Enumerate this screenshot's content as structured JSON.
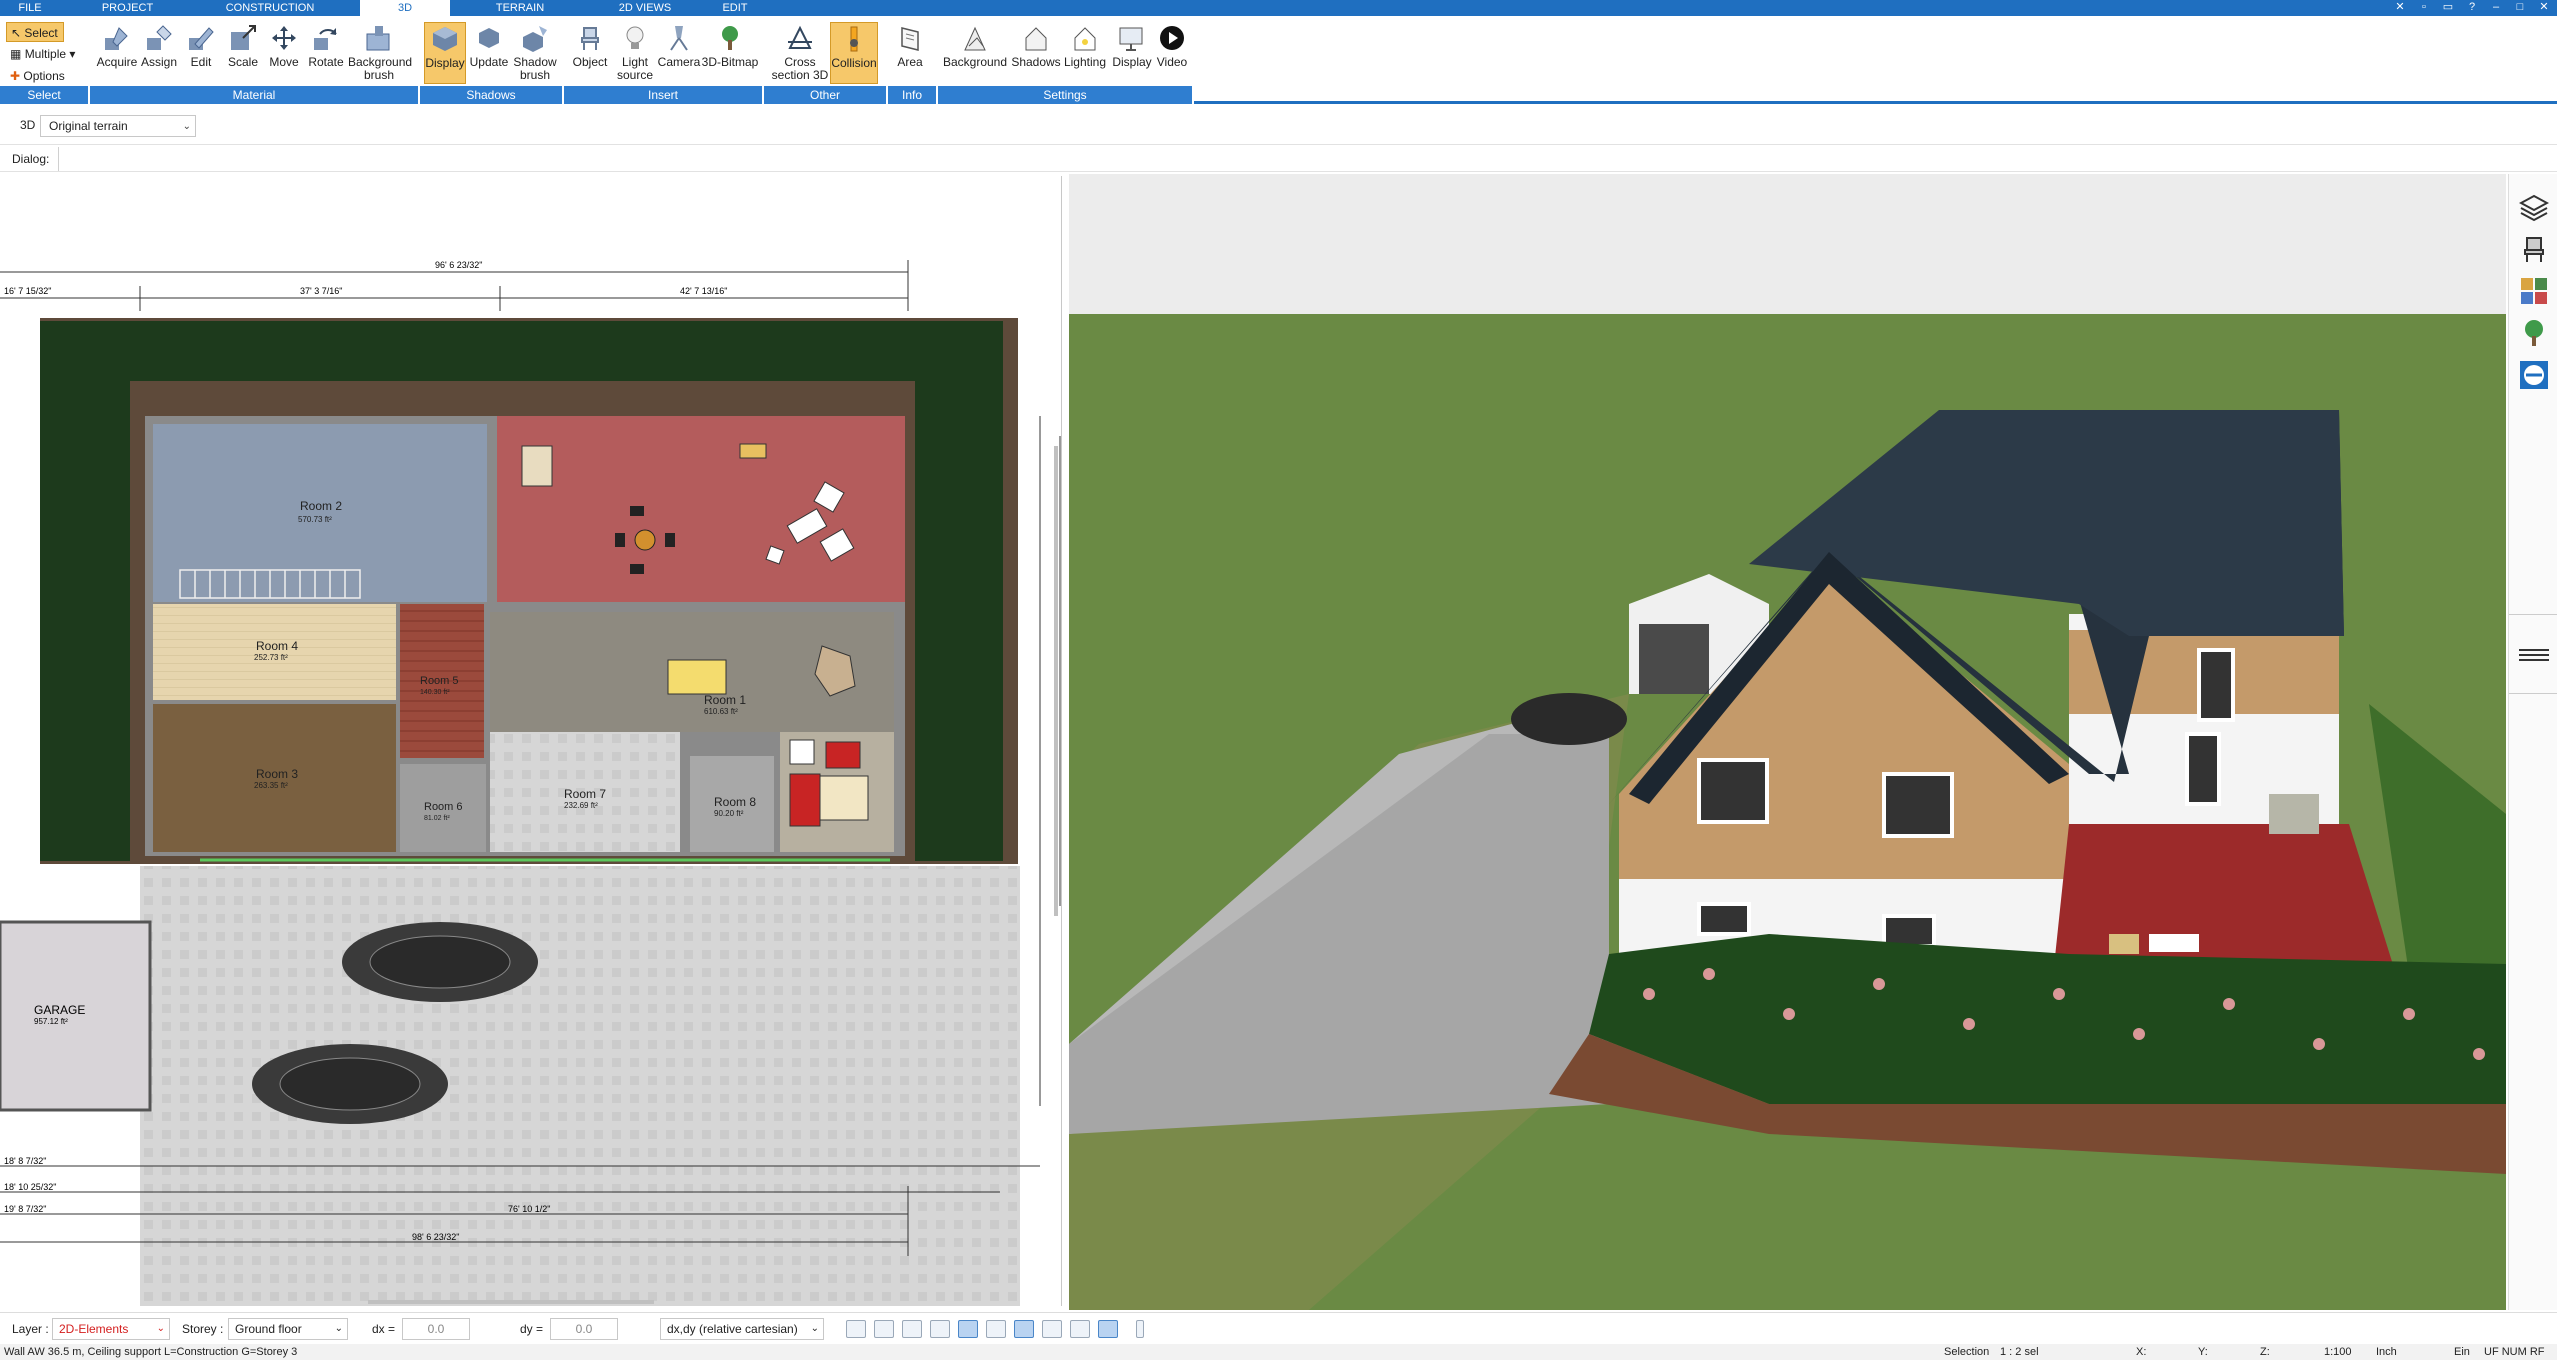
{
  "menu": {
    "tabs": [
      "FILE",
      "PROJECT",
      "CONSTRUCTION",
      "3D",
      "TERRAIN",
      "2D VIEWS",
      "EDIT"
    ],
    "active": "3D"
  },
  "ribbon": {
    "select_group": {
      "select": "Select",
      "multiple": "Multiple",
      "options": "Options",
      "label": "Select"
    },
    "material": {
      "buttons": [
        "Acquire",
        "Assign",
        "Edit",
        "Scale",
        "Move",
        "Rotate",
        "Background brush"
      ],
      "label": "Material"
    },
    "shadows": {
      "buttons": [
        "Display",
        "Update",
        "Shadow brush"
      ],
      "label": "Shadows"
    },
    "insert": {
      "buttons": [
        "Object",
        "Light source",
        "Camera",
        "3D-Bitmap"
      ],
      "label": "Insert"
    },
    "other": {
      "buttons": [
        "Cross section 3D",
        "Collision"
      ],
      "label": "Other"
    },
    "info": {
      "buttons": [
        "Area"
      ],
      "label": "Info"
    },
    "settings": {
      "buttons": [
        "Background",
        "Shadows",
        "Lighting",
        "Display",
        "Video"
      ],
      "label": "Settings"
    }
  },
  "toolbar3d": {
    "label": "3D",
    "terrain": "Original terrain"
  },
  "dialog": {
    "label": "Dialog:"
  },
  "plan": {
    "rooms": [
      {
        "name": "Room 2",
        "area": "570.73 ft²"
      },
      {
        "name": "Room 4",
        "area": "252.73 ft²"
      },
      {
        "name": "Room 3",
        "area": "263.35 ft²"
      },
      {
        "name": "Room 5",
        "area": "140.30 ft²"
      },
      {
        "name": "Room 1",
        "area": "610.63 ft²"
      },
      {
        "name": "Room 7",
        "area": "232.69 ft²"
      },
      {
        "name": "Room 6",
        "area": "81.02 ft²"
      },
      {
        "name": "Room 8",
        "area": "90.20 ft²"
      },
      {
        "name": "GARAGE",
        "area": "957.12 ft²"
      }
    ],
    "dims_top": [
      "96' 6 23/32\"",
      "16' 7 15/32\"",
      "37' 3 7/16\"",
      "42' 7 13/16\""
    ],
    "dims_bottom": [
      "18' 8 7/32\"",
      "18' 10 25/32\"",
      "19' 8 7/32\"",
      "76' 10 1/2\"",
      "98' 6 23/32\""
    ]
  },
  "status": {
    "layer_label": "Layer :",
    "layer_value": "2D-Elements",
    "storey_label": "Storey :",
    "storey_value": "Ground floor",
    "dx_label": "dx =",
    "dx_value": "0.0",
    "dy_label": "dy =",
    "dy_value": "0.0",
    "coord_mode": "dx,dy (relative cartesian)"
  },
  "info": {
    "message": "Wall AW 36.5 m, Ceiling support L=Construction G=Storey 3",
    "selection": "Selection",
    "selection_value": "1 : 2 sel",
    "x": "X:",
    "y": "Y:",
    "z": "Z:",
    "scale": "1:100",
    "unit": "Inch",
    "ein": "Ein",
    "flags": "UF  NUM  RF"
  },
  "colors": {
    "accent": "#1f6fc0",
    "active": "#f6c86a",
    "layer_red": "#d42020"
  }
}
